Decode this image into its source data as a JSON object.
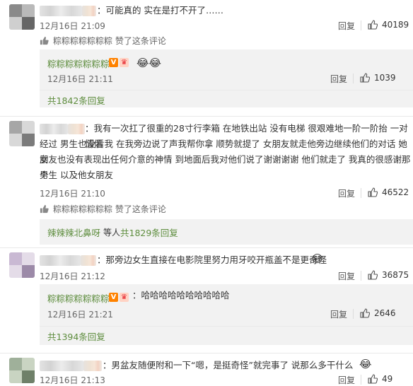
{
  "comments": [
    {
      "text": "：可能真的 实在是打不开了……",
      "time": "12月16日 21:09",
      "reply_label": "回复",
      "likes": "40189",
      "author_liked": "粽粽粽粽粽粽粽 赞了这条评论",
      "sub_reply": {
        "user": "粽粽粽粽粽粽粽",
        "time": "12月16日 21:11",
        "reply_label": "回复",
        "likes": "1039"
      },
      "more_replies": "共1842条回复"
    },
    {
      "text_line1": "：我有一次扛了很重的28寸行李箱 在地铁出站 没有电梯 很艰难地一阶一阶抬 一对情侣",
      "text_line2": "经过  男生也没看我  在我旁边说了声我帮你拿 顺势就提了 女朋友就走他旁边继续他们的对话 她女",
      "text_line3": "朋友也没有表现出任何介意的神情 到地面后我对他们说了谢谢谢谢 他们就走了 我真的很感谢那个",
      "text_line4": "男生 以及他女朋友",
      "time": "12月16日 21:10",
      "reply_label": "回复",
      "likes": "46522",
      "author_liked": "粽粽粽粽粽粽粽 赞了这条评论",
      "replier": "辣辣辣北鼻呀",
      "replier_suffix": "等人",
      "more_replies": "共1829条回复"
    },
    {
      "text": "：那旁边女生直接在电影院里努力用牙咬开瓶盖不是更奇怪",
      "time": "12月16日 21:12",
      "reply_label": "回复",
      "likes": "36875",
      "sub_reply": {
        "user": "粽粽粽粽粽粽粽",
        "text": "：哈哈哈哈哈哈哈哈哈哈",
        "time": "12月16日 21:21",
        "reply_label": "回复",
        "likes": "2646"
      },
      "more_replies": "共1394条回复"
    },
    {
      "text": "：男盆友随便附和一下“嗯，是挺奇怪”就完事了 说那么多干什么",
      "time": "12月16日 21:13",
      "reply_label": "回复",
      "likes": "49"
    }
  ],
  "icons": {
    "like": "thumbs-up-icon",
    "author_like": "heart-thumb-icon",
    "verified": "v-badge-icon",
    "emoji_laugh": "laughing-emoji-icon",
    "emoji_sweat": "sweat-smile-emoji-icon"
  },
  "colors": {
    "link_green": "#5e8d3e",
    "verified": "#ff8200"
  }
}
